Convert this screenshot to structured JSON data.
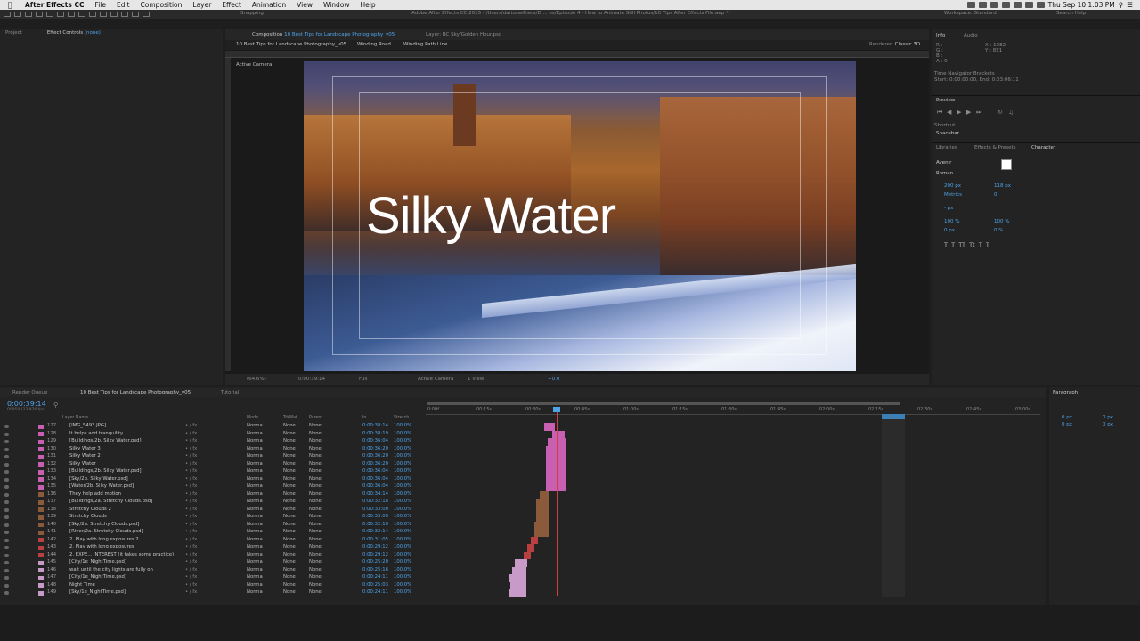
{
  "menubar": {
    "app": "After Effects CC",
    "items": [
      "File",
      "Edit",
      "Composition",
      "Layer",
      "Effect",
      "Animation",
      "View",
      "Window",
      "Help"
    ],
    "clock": "Thu Sep 10  1:03 PM"
  },
  "titlebar": {
    "title": "Adobe After Effects CC 2015 - /Users/dariuswilhere/D ... es/Episode 4 - How to Animate Still Photos/10 Tips After Effects File.aep *",
    "snapping": "Snapping",
    "workspace_label": "Workspace:",
    "workspace_value": "Standard",
    "search_help": "Search Help"
  },
  "left_panel": {
    "tab_project": "Project",
    "tab_effect_controls": "Effect Controls",
    "effect_controls_target": "(none)"
  },
  "viewer": {
    "tab_composition": "Composition",
    "tab_composition_name": "10 Best Tips for Landscape Photography_v05",
    "tab_layer": "Layer: BC Sky/Golden Hour.psd",
    "breadcrumb": [
      "10 Best Tips for Landscape Photography_v05",
      "Winding Road",
      "Winding Path Line"
    ],
    "renderer_label": "Renderer:",
    "renderer_value": "Classic 3D",
    "active_camera": "Active Camera",
    "headline": "Silky Water",
    "footer": {
      "zoom": "(64.6%)",
      "timecode": "0:00:39:14",
      "resolution": "Full",
      "view": "Active Camera",
      "views": "1 View",
      "exposure": "+0.0"
    }
  },
  "right_panel": {
    "tab_info": "Info",
    "tab_audio": "Audio",
    "x_label": "X : 1282",
    "y_label": "Y : 821",
    "r": "R :",
    "g": "G :",
    "b": "B :",
    "a": "A : 0",
    "time_navigator": "Time Navigator Brackets",
    "tn_range": "Start: 0:00:00:00, End: 0:03:06:11",
    "preview": "Preview",
    "shortcut_label": "Shortcut",
    "shortcut_value": "Spacebar",
    "tab_libraries": "Libraries",
    "tab_effects_presets": "Effects & Presets",
    "tab_character": "Character",
    "font": "Avenir",
    "style": "Roman",
    "font_size": "200 px",
    "leading": "118 px",
    "metrics": "Metrics",
    "tracking": "0",
    "stroke": "- px",
    "vscale": "100 %",
    "hscale": "100 %",
    "baseline": "0 px",
    "tsume": "0 %",
    "tab_paragraph": "Paragraph",
    "para_indent1": "0 px",
    "para_indent2": "0 px",
    "para_indent3": "0 px",
    "para_indent4": "0 px"
  },
  "timeline": {
    "tab_render_queue": "Render Queue",
    "tab_comp": "10 Best Tips for Landscape Photography_v05",
    "tab_tutorial": "Tutorial",
    "current_time": "0:00:39:14",
    "frame_info": "00950 (23.976 fps)",
    "col_layer_name": "Layer Name",
    "col_mode": "Mode",
    "col_trkmat": "TrkMat",
    "col_parent": "Parent",
    "col_in": "In",
    "col_stretch": "Stretch",
    "ruler": [
      "0:00f",
      "00:15s",
      "00:30s",
      "00:45s",
      "01:00s",
      "01:15s",
      "01:30s",
      "01:45s",
      "02:00s",
      "02:15s",
      "02:30s",
      "02:45s",
      "03:00s"
    ],
    "rows": [
      {
        "num": "127",
        "name": "[IMG_5493.JPG]",
        "mode": "Norma",
        "trk": "None",
        "parent": "None",
        "in": "0:00:38:14",
        "stretch": "100.0%",
        "color": "#c85fb0",
        "bar_start": 611,
        "bar_w": 12
      },
      {
        "num": "128",
        "name": "It helps add tranquility",
        "mode": "Norma",
        "trk": "None",
        "parent": "None",
        "in": "0:00:38:19",
        "stretch": "100.0%",
        "color": "#c85fb0",
        "bar_start": 620,
        "bar_w": 14
      },
      {
        "num": "129",
        "name": "[Buildings/2b. Silky Water.psd]",
        "mode": "Norma",
        "trk": "None",
        "parent": "None",
        "in": "0:00:36:04",
        "stretch": "100.0%",
        "color": "#c85fb0",
        "bar_start": 615,
        "bar_w": 20
      },
      {
        "num": "130",
        "name": "Silky Water 3",
        "mode": "Norma",
        "trk": "None",
        "parent": "None",
        "in": "0:00:36:20",
        "stretch": "100.0%",
        "color": "#c85fb0",
        "bar_start": 613,
        "bar_w": 22
      },
      {
        "num": "131",
        "name": "Silky Water 2",
        "mode": "Norma",
        "trk": "None",
        "parent": "None",
        "in": "0:00:36:20",
        "stretch": "100.0%",
        "color": "#c85fb0",
        "bar_start": 613,
        "bar_w": 22
      },
      {
        "num": "132",
        "name": "Silky Water",
        "mode": "Norma",
        "trk": "None",
        "parent": "None",
        "in": "0:00:36:20",
        "stretch": "100.0%",
        "color": "#c85fb0",
        "bar_start": 613,
        "bar_w": 22
      },
      {
        "num": "133",
        "name": "[Buildings/2b. Silky Water.psd]",
        "mode": "Norma",
        "trk": "None",
        "parent": "None",
        "in": "0:00:36:04",
        "stretch": "100.0%",
        "color": "#c85fb0",
        "bar_start": 613,
        "bar_w": 22
      },
      {
        "num": "134",
        "name": "[Sky/2b. Silky Water.psd]",
        "mode": "Norma",
        "trk": "None",
        "parent": "None",
        "in": "0:00:36:04",
        "stretch": "100.0%",
        "color": "#c85fb0",
        "bar_start": 613,
        "bar_w": 22
      },
      {
        "num": "135",
        "name": "[Water/2b. Silky Water.psd]",
        "mode": "Norma",
        "trk": "None",
        "parent": "None",
        "in": "0:00:36:04",
        "stretch": "100.0%",
        "color": "#c85fb0",
        "bar_start": 613,
        "bar_w": 22
      },
      {
        "num": "136",
        "name": "They help add motion",
        "mode": "Norma",
        "trk": "None",
        "parent": "None",
        "in": "0:00:34:14",
        "stretch": "100.0%",
        "color": "#8a5a3a",
        "bar_start": 606,
        "bar_w": 10
      },
      {
        "num": "137",
        "name": "[Buildings/2a. Stretchy Clouds.psd]",
        "mode": "Norma",
        "trk": "None",
        "parent": "None",
        "in": "0:00:32:18",
        "stretch": "100.0%",
        "color": "#8a5a3a",
        "bar_start": 602,
        "bar_w": 14
      },
      {
        "num": "138",
        "name": "Stretchy Clouds 2",
        "mode": "Norma",
        "trk": "None",
        "parent": "None",
        "in": "0:00:33:00",
        "stretch": "100.0%",
        "color": "#8a5a3a",
        "bar_start": 602,
        "bar_w": 14
      },
      {
        "num": "139",
        "name": "Stretchy Clouds",
        "mode": "Norma",
        "trk": "None",
        "parent": "None",
        "in": "0:00:33:00",
        "stretch": "100.0%",
        "color": "#8a5a3a",
        "bar_start": 602,
        "bar_w": 14
      },
      {
        "num": "140",
        "name": "[Sky/2a. Stretchy Clouds.psd]",
        "mode": "Norma",
        "trk": "None",
        "parent": "None",
        "in": "0:00:32:10",
        "stretch": "100.0%",
        "color": "#8a5a3a",
        "bar_start": 600,
        "bar_w": 16
      },
      {
        "num": "141",
        "name": "[River/2a. Stretchy Clouds.psd]",
        "mode": "Norma",
        "trk": "None",
        "parent": "None",
        "in": "0:00:32:14",
        "stretch": "100.0%",
        "color": "#8a5a3a",
        "bar_start": 600,
        "bar_w": 16
      },
      {
        "num": "142",
        "name": "2. Play with long exposures 2",
        "mode": "Norma",
        "trk": "None",
        "parent": "None",
        "in": "0:00:31:05",
        "stretch": "100.0%",
        "color": "#b84040",
        "bar_start": 596,
        "bar_w": 8
      },
      {
        "num": "143",
        "name": "2. Play with long exposures",
        "mode": "Norma",
        "trk": "None",
        "parent": "None",
        "in": "0:00:29:12",
        "stretch": "100.0%",
        "color": "#b84040",
        "bar_start": 592,
        "bar_w": 8
      },
      {
        "num": "144",
        "name": "2. EXPE... INTEREST (it takes some practice)",
        "mode": "Norma",
        "trk": "None",
        "parent": "None",
        "in": "0:00:29:12",
        "stretch": "100.0%",
        "color": "#b84040",
        "bar_start": 588,
        "bar_w": 8
      },
      {
        "num": "145",
        "name": "[City/1e_NightTime.psd]",
        "mode": "Norma",
        "trk": "None",
        "parent": "None",
        "in": "0:00:25:20",
        "stretch": "100.0%",
        "color": "#c89ac8",
        "bar_start": 578,
        "bar_w": 14
      },
      {
        "num": "146",
        "name": "wait until the city lights are fully on",
        "mode": "Norma",
        "trk": "None",
        "parent": "None",
        "in": "0:00:25:16",
        "stretch": "100.0%",
        "color": "#c89ac8",
        "bar_start": 575,
        "bar_w": 16
      },
      {
        "num": "147",
        "name": "[City/1e_NightTime.psd]",
        "mode": "Norma",
        "trk": "None",
        "parent": "None",
        "in": "0:00:24:11",
        "stretch": "100.0%",
        "color": "#c89ac8",
        "bar_start": 571,
        "bar_w": 20
      },
      {
        "num": "148",
        "name": "Night Time",
        "mode": "Norma",
        "trk": "None",
        "parent": "None",
        "in": "0:00:25:03",
        "stretch": "100.0%",
        "color": "#c89ac8",
        "bar_start": 573,
        "bar_w": 18
      },
      {
        "num": "149",
        "name": "[Sky/1e_NightTime.psd]",
        "mode": "Norma",
        "trk": "None",
        "parent": "None",
        "in": "0:00:24:11",
        "stretch": "100.0%",
        "color": "#c89ac8",
        "bar_start": 571,
        "bar_w": 20
      }
    ]
  }
}
